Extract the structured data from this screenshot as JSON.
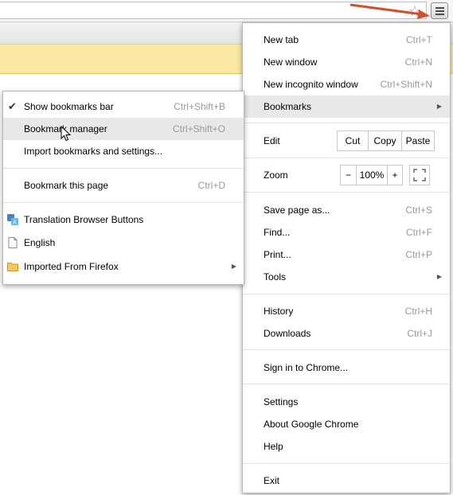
{
  "toolbar": {
    "bookmark_star_icon": "star-icon",
    "menu_icon": "hamburger-menu-icon",
    "annotation_color": "#d0502e"
  },
  "main_menu": {
    "new_tab": {
      "label": "New tab",
      "shortcut": "Ctrl+T"
    },
    "new_window": {
      "label": "New window",
      "shortcut": "Ctrl+N"
    },
    "new_incognito": {
      "label": "New incognito window",
      "shortcut": "Ctrl+Shift+N"
    },
    "bookmarks": {
      "label": "Bookmarks"
    },
    "edit": {
      "label": "Edit",
      "cut": "Cut",
      "copy": "Copy",
      "paste": "Paste"
    },
    "zoom": {
      "label": "Zoom",
      "minus": "−",
      "level": "100%",
      "plus": "+"
    },
    "save_page": {
      "label": "Save page as...",
      "shortcut": "Ctrl+S"
    },
    "find": {
      "label": "Find...",
      "shortcut": "Ctrl+F"
    },
    "print": {
      "label": "Print...",
      "shortcut": "Ctrl+P"
    },
    "tools": {
      "label": "Tools"
    },
    "history": {
      "label": "History",
      "shortcut": "Ctrl+H"
    },
    "downloads": {
      "label": "Downloads",
      "shortcut": "Ctrl+J"
    },
    "sign_in": {
      "label": "Sign in to Chrome..."
    },
    "settings": {
      "label": "Settings"
    },
    "about": {
      "label": "About Google Chrome"
    },
    "help": {
      "label": "Help"
    },
    "exit": {
      "label": "Exit"
    }
  },
  "bookmarks_submenu": {
    "show_bar": {
      "label": "Show bookmarks bar",
      "shortcut": "Ctrl+Shift+B",
      "checked": true
    },
    "manager": {
      "label": "Bookmark manager",
      "shortcut": "Ctrl+Shift+O"
    },
    "import": {
      "label": "Import bookmarks and settings..."
    },
    "bookmark_page": {
      "label": "Bookmark this page",
      "shortcut": "Ctrl+D"
    },
    "items": [
      {
        "label": "Translation Browser Buttons",
        "icon": "translate-icon"
      },
      {
        "label": "English",
        "icon": "page-icon"
      },
      {
        "label": "Imported From Firefox",
        "icon": "folder-icon"
      }
    ]
  }
}
